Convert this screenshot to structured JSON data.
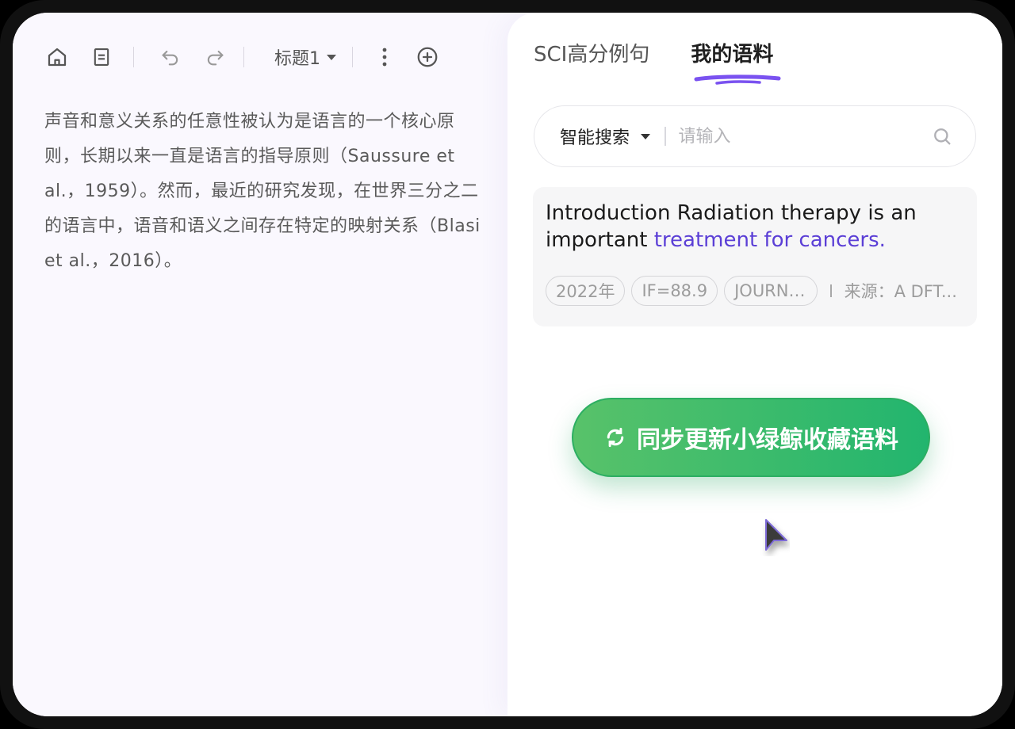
{
  "toolbar": {
    "heading_label": "标题1",
    "icons": [
      "home-icon",
      "document-icon",
      "undo-icon",
      "redo-icon",
      "more-vertical-icon",
      "add-circle-icon"
    ]
  },
  "editor": {
    "paragraph": "声音和意义关系的任意性被认为是语言的一个核心原则，长期以来一直是语言的指导原则（Saussure et al.，1959）。然而，最近的研究发现，在世界三分之二的语言中，语音和语义之间存在特定的映射关系（Blasi et al.，2016）。"
  },
  "panel": {
    "tabs": [
      {
        "label": "SCI高分例句",
        "active": false
      },
      {
        "label": "我的语料",
        "active": true
      }
    ],
    "search": {
      "mode_label": "智能搜索",
      "placeholder": "请输入",
      "value": ""
    },
    "card": {
      "text_plain": "Introduction Radiation therapy is an important ",
      "text_highlight": "treatment for cancers.",
      "chips": [
        "2022年",
        "IF=88.9",
        "JOURNAL"
      ],
      "source": "来源：A DFT..."
    },
    "sync_button_label": "同步更新小绿鲸收藏语料"
  },
  "colors": {
    "accent": "#5b3fd6",
    "button_start": "#58c26a",
    "button_end": "#22b56e"
  }
}
